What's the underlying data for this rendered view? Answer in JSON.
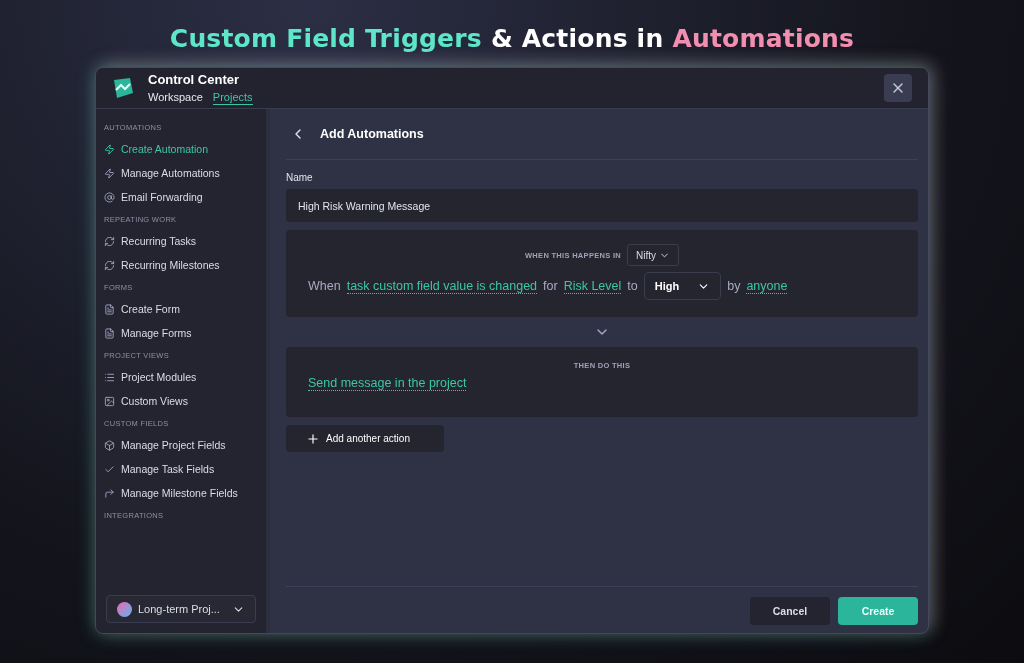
{
  "headline": [
    {
      "text": "Custom Field Triggers",
      "color": "#5ee6c8"
    },
    {
      "text": "& Actions in",
      "color": "#ffffff"
    },
    {
      "text": "Automations",
      "color": "#f28fb0"
    }
  ],
  "window": {
    "title": "Control Center",
    "tabs": [
      {
        "label": "Workspace",
        "selected": false
      },
      {
        "label": "Projects",
        "selected": true
      }
    ]
  },
  "sidebar": {
    "sections": [
      {
        "title": "AUTOMATIONS",
        "items": [
          {
            "label": "Create Automation",
            "selected": true
          },
          {
            "label": "Manage Automations",
            "selected": false
          },
          {
            "label": "Email Forwarding",
            "selected": false
          }
        ]
      },
      {
        "title": "REPEATING WORK",
        "items": [
          {
            "label": "Recurring Tasks",
            "selected": false
          },
          {
            "label": "Recurring Milestones",
            "selected": false
          }
        ]
      },
      {
        "title": "FORMS",
        "items": [
          {
            "label": "Create Form",
            "selected": false
          },
          {
            "label": "Manage Forms",
            "selected": false
          }
        ]
      },
      {
        "title": "PROJECT VIEWS",
        "items": [
          {
            "label": "Project Modules",
            "selected": false
          },
          {
            "label": "Custom Views",
            "selected": false
          }
        ]
      },
      {
        "title": "CUSTOM FIELDS",
        "items": [
          {
            "label": "Manage Project Fields",
            "selected": false
          },
          {
            "label": "Manage Task Fields",
            "selected": false
          },
          {
            "label": "Manage Milestone Fields",
            "selected": false
          }
        ]
      },
      {
        "title": "INTEGRATIONS"
      }
    ],
    "project_select": "Long-term Proj..."
  },
  "main": {
    "title": "Add Automations",
    "name_label": "Name",
    "name_value": "High Risk Warning Message",
    "trigger": {
      "caption": "WHEN THIS HAPPENS IN",
      "source": "Nifty",
      "sentence": [
        {
          "kind": "text",
          "text": "When"
        },
        {
          "kind": "link",
          "text": "task custom field value is changed"
        },
        {
          "kind": "text",
          "text": "for"
        },
        {
          "kind": "link",
          "text": "Risk Level"
        },
        {
          "kind": "text",
          "text": "to"
        },
        {
          "kind": "select",
          "text": "High"
        },
        {
          "kind": "text",
          "text": "by"
        },
        {
          "kind": "link",
          "text": "anyone"
        }
      ]
    },
    "action": {
      "caption": "THEN DO THIS",
      "text": "Send message in the project"
    },
    "add_action": "Add another action",
    "buttons": {
      "cancel": "Cancel",
      "create": "Create"
    }
  }
}
